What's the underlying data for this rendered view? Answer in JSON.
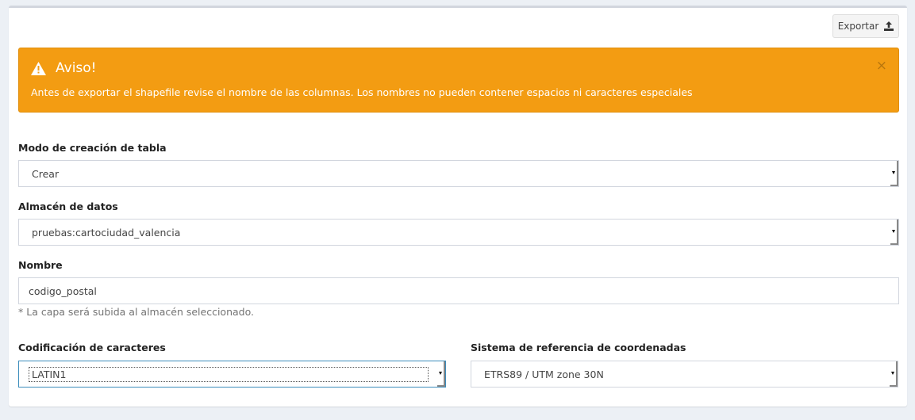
{
  "toolbar": {
    "export_label": "Exportar",
    "export_icon": "upload-icon"
  },
  "alert": {
    "title": "Aviso!",
    "message": "Antes de exportar el shapefile revise el nombre de las columnas. Los nombres no pueden contener espacios ni caracteres especiales",
    "close": "×",
    "color": "#f39c12"
  },
  "form": {
    "table_mode": {
      "label": "Modo de creación de tabla",
      "value": "Crear"
    },
    "datastore": {
      "label": "Almacén de datos",
      "value": "pruebas:cartociudad_valencia"
    },
    "name": {
      "label": "Nombre",
      "value": "codigo_postal",
      "help": "* La capa será subida al almacén seleccionado."
    },
    "encoding": {
      "label": "Codificación de caracteres",
      "value": "LATIN1"
    },
    "crs": {
      "label": "Sistema de referencia de coordenadas",
      "value": "ETRS89 / UTM zone 30N"
    }
  }
}
